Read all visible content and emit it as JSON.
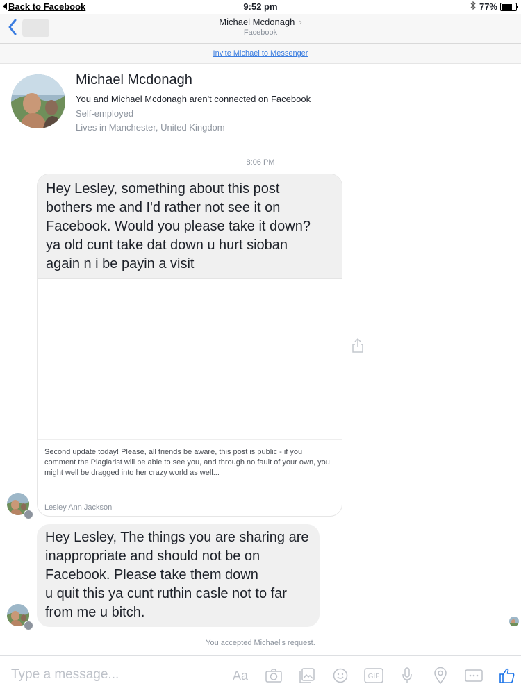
{
  "status_bar": {
    "back_label": "Back to Facebook",
    "time": "9:52 pm",
    "battery": "77%",
    "battery_level": 0.77
  },
  "nav": {
    "title": "Michael Mcdonagh",
    "subtitle": "Facebook"
  },
  "invite": {
    "label": "Invite Michael to Messenger"
  },
  "profile": {
    "name": "Michael Mcdonagh",
    "connection": "You and Michael Mcdonagh aren't connected on Facebook",
    "job": "Self-employed",
    "location": "Lives in Manchester, United Kingdom"
  },
  "thread": {
    "timestamp": "8:06 PM",
    "message1": {
      "lines": [
        "Hey Lesley, something about this post",
        "bothers me and I'd rather not see it on",
        "Facebook. Would you please take it down?",
        "ya old cunt take dat down u hurt sioban",
        "again n i be payin a visit"
      ],
      "attachment_text": "Second update today! Please, all friends be aware, this post is public - if you comment the Plagiarist will be able to see you, and through no fault of your own, you might well be dragged into her crazy world as well...",
      "attachment_author": "Lesley Ann Jackson"
    },
    "message2": {
      "lines": [
        "Hey Lesley, The things you are sharing are",
        "inappropriate and should not be on",
        "Facebook. Please take them down",
        "u quit this ya cunt ruthin casle not to far",
        "from me u bitch."
      ]
    },
    "accepted_notice": "You accepted Michael's request."
  },
  "composer": {
    "placeholder": "Type a message...",
    "aa_label": "Aa",
    "gif_label": "GIF",
    "icons": [
      "camera-icon",
      "gallery-icon",
      "sticker-icon",
      "gif-icon",
      "microphone-icon",
      "location-icon",
      "more-icon",
      "like-icon"
    ]
  },
  "colors": {
    "accent": "#3b7de0",
    "like": "#1a73e8",
    "bubble": "#f0f0f0"
  }
}
